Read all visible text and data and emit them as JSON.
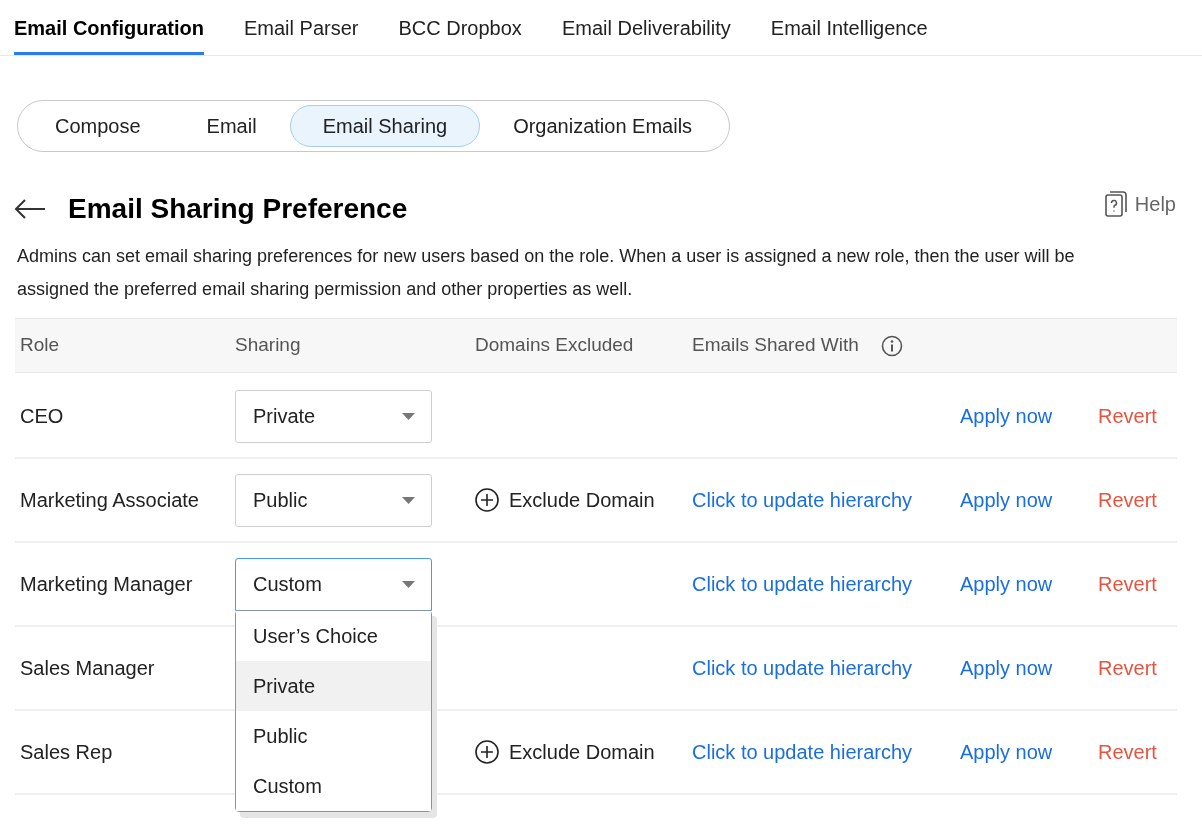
{
  "top_tabs": [
    {
      "label": "Email Configuration",
      "selected": true
    },
    {
      "label": "Email Parser",
      "selected": false
    },
    {
      "label": "BCC Dropbox",
      "selected": false
    },
    {
      "label": "Email Deliverability",
      "selected": false
    },
    {
      "label": "Email Intelligence",
      "selected": false
    }
  ],
  "sub_tabs": [
    {
      "label": "Compose",
      "selected": false
    },
    {
      "label": "Email",
      "selected": false
    },
    {
      "label": "Email Sharing",
      "selected": true
    },
    {
      "label": "Organization Emails",
      "selected": false
    }
  ],
  "page": {
    "title": "Email Sharing Preference",
    "help": "Help",
    "description": "Admins can set email sharing preferences for new users based on the role. When a user is assigned a new role, then the user will be assigned the preferred email sharing permission and other properties as well."
  },
  "table": {
    "columns": [
      "Role",
      "Sharing",
      "Domains Excluded",
      "Emails Shared With"
    ],
    "rows": [
      {
        "role": "CEO",
        "sharing": {
          "value": "Private",
          "open": false
        },
        "exclude_domain": null,
        "hierarchy_link": null,
        "apply": "Apply now",
        "revert": "Revert"
      },
      {
        "role": "Marketing Associate",
        "sharing": {
          "value": "Public",
          "open": false
        },
        "exclude_domain": "Exclude Domain",
        "hierarchy_link": "Click to update hierarchy",
        "apply": "Apply now",
        "revert": "Revert"
      },
      {
        "role": "Marketing Manager",
        "sharing": {
          "value": "Custom",
          "open": true,
          "options": [
            {
              "label": "User’s Choice",
              "hovered": false
            },
            {
              "label": "Private",
              "hovered": true
            },
            {
              "label": "Public",
              "hovered": false
            },
            {
              "label": "Custom",
              "hovered": false
            }
          ]
        },
        "exclude_domain": null,
        "hierarchy_link": "Click to update hierarchy",
        "apply": "Apply now",
        "revert": "Revert"
      },
      {
        "role": "Sales Manager",
        "sharing": null,
        "exclude_domain": null,
        "hierarchy_link": "Click to update hierarchy",
        "apply": "Apply now",
        "revert": "Revert"
      },
      {
        "role": "Sales Rep",
        "sharing": null,
        "exclude_domain": "Exclude Domain",
        "hierarchy_link": "Click to update hierarchy",
        "apply": "Apply now",
        "revert": "Revert"
      }
    ]
  }
}
